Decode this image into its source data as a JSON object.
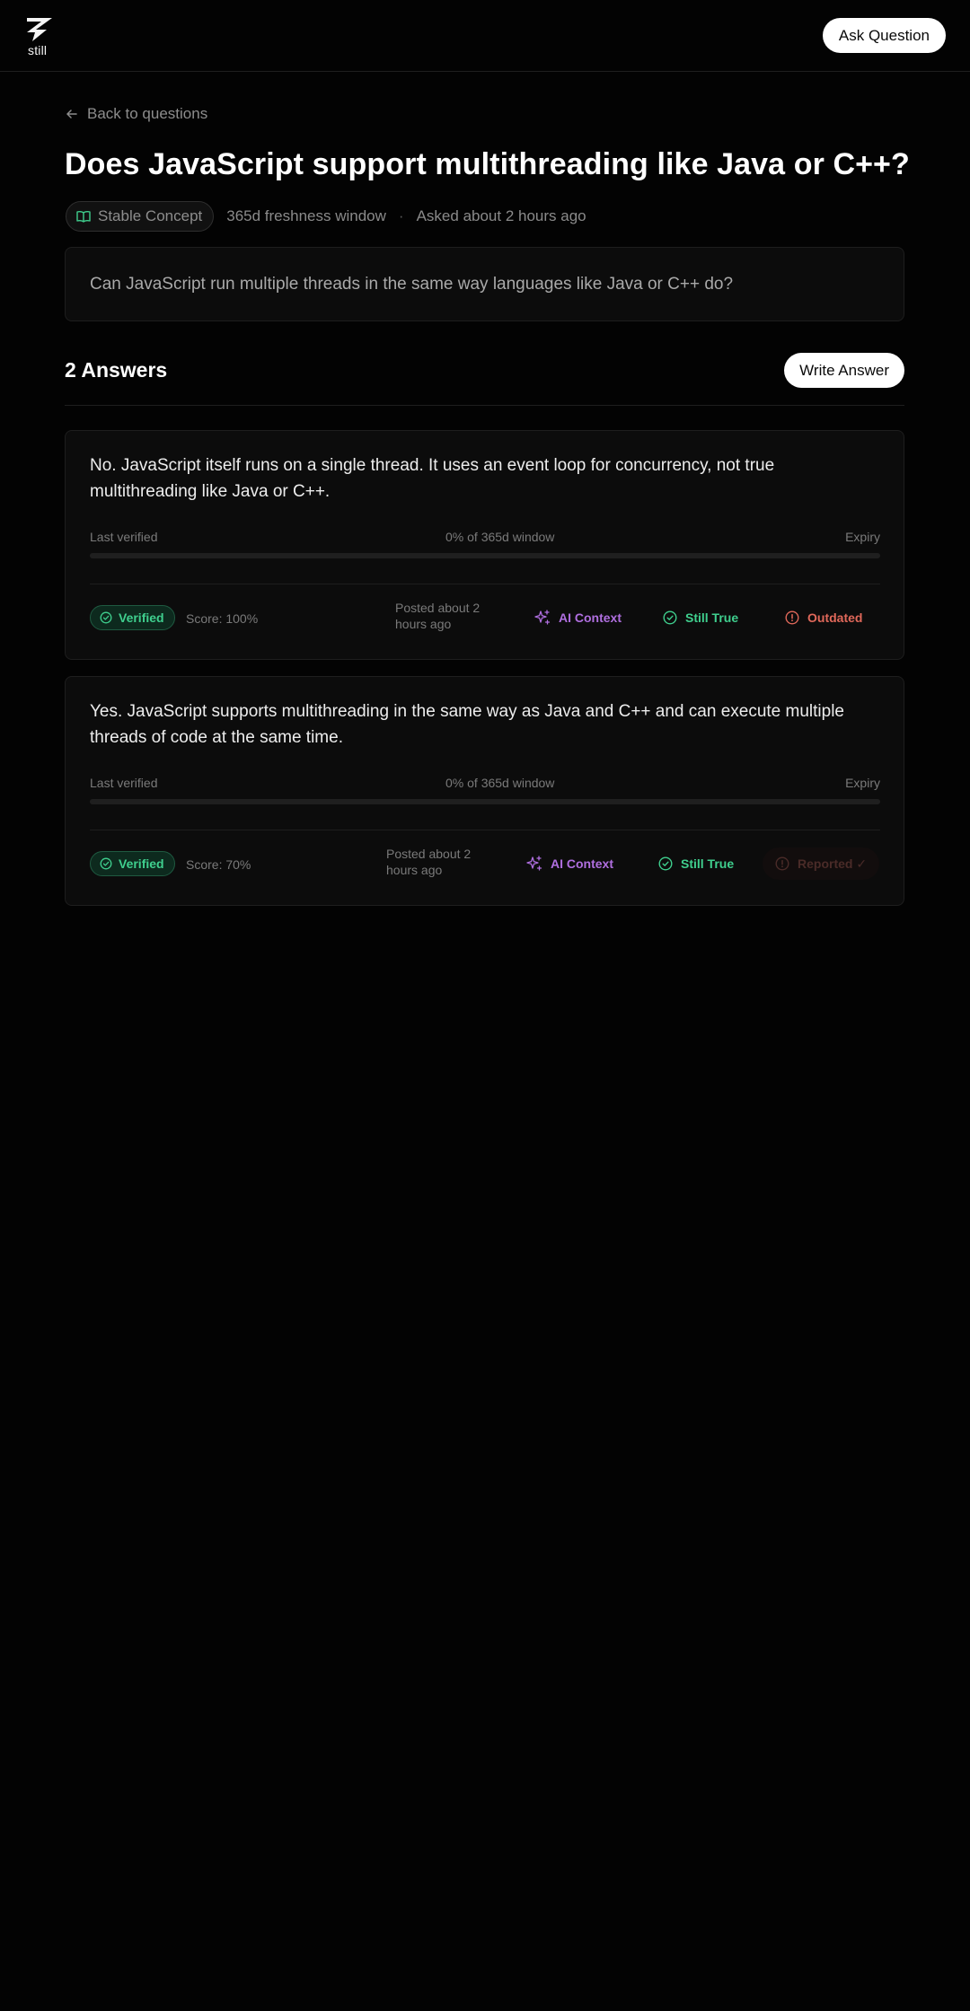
{
  "app": {
    "logo_text": "still"
  },
  "header": {
    "ask_label": "Ask Question"
  },
  "back_label": "Back to questions",
  "question": {
    "title": "Does JavaScript support multithreading like Java or C++?",
    "tag": "Stable Concept",
    "freshness": "365d freshness window",
    "separator": "·",
    "asked": "Asked about 2 hours ago",
    "body": "Can JavaScript run multiple threads in the same way languages like Java or C++ do?"
  },
  "answers_section": {
    "count_label": "2 Answers",
    "write_label": "Write Answer"
  },
  "answers": [
    {
      "text": "No. JavaScript itself runs on a single thread. It uses an event loop for concurrency, not true multithreading like Java or C++.",
      "last_verified_label": "Last verified",
      "window_label": "0% of 365d window",
      "expiry_label": "Expiry",
      "progress": 0,
      "verified_label": "Verified",
      "score": "Score: 100%",
      "posted": "Posted about 2 hours ago",
      "ai_label": "AI Context",
      "still_label": "Still True",
      "outdated_label": "Outdated"
    },
    {
      "text": "Yes. JavaScript supports multithreading in the same way as Java and C++ and can execute multiple threads of code at the same time.",
      "last_verified_label": "Last verified",
      "window_label": "0% of 365d window",
      "expiry_label": "Expiry",
      "progress": 0,
      "verified_label": "Verified",
      "score": "Score: 70%",
      "posted": "Posted about 2 hours ago",
      "ai_label": "AI Context",
      "still_label": "Still True",
      "reported_label": "Reported ✓"
    }
  ],
  "colors": {
    "background": "#030303",
    "accent_green": "#3fcf8e",
    "accent_purple": "#b06fe0",
    "accent_red": "#e0685a"
  },
  "icons": [
    "logo-icon",
    "arrow-left-icon",
    "book-open-icon",
    "check-circle-icon",
    "sparkles-icon",
    "alert-circle-icon"
  ]
}
